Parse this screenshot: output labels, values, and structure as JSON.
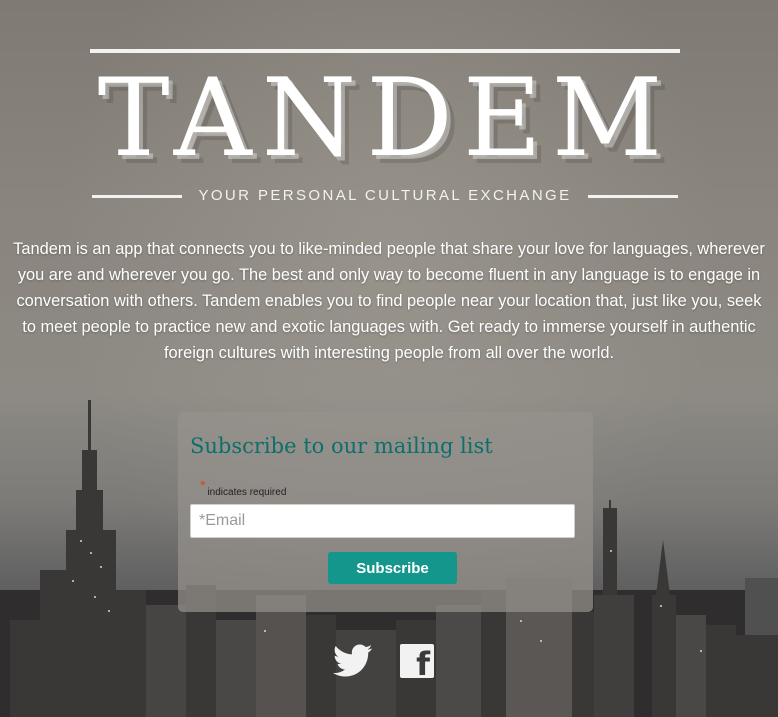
{
  "brand": {
    "logo": "TANDEM",
    "tagline": "YOUR PERSONAL CULTURAL EXCHANGE"
  },
  "intro": {
    "text": "Tandem is an app that connects you to like-minded people that share your love for languages, wherever you are and wherever you go. The best and only way to become fluent in any language is to engage in conversation with others. Tandem enables you to find people near your location that, just like you, seek to meet people to practice new and exotic languages with. Get ready to immerse yourself in authentic foreign cultures with interesting people from all over the world."
  },
  "signup": {
    "title": "Subscribe to our mailing list",
    "required_star": "*",
    "required_note": "indicates required",
    "email_placeholder": "*Email",
    "email_value": "",
    "button_label": "Subscribe"
  },
  "social": {
    "facebook_glyph": "f",
    "icons": [
      "twitter-icon",
      "facebook-icon"
    ]
  },
  "colors": {
    "accent": "#14968c",
    "heading": "#0d6f6b",
    "required_star": "#d6471c"
  }
}
